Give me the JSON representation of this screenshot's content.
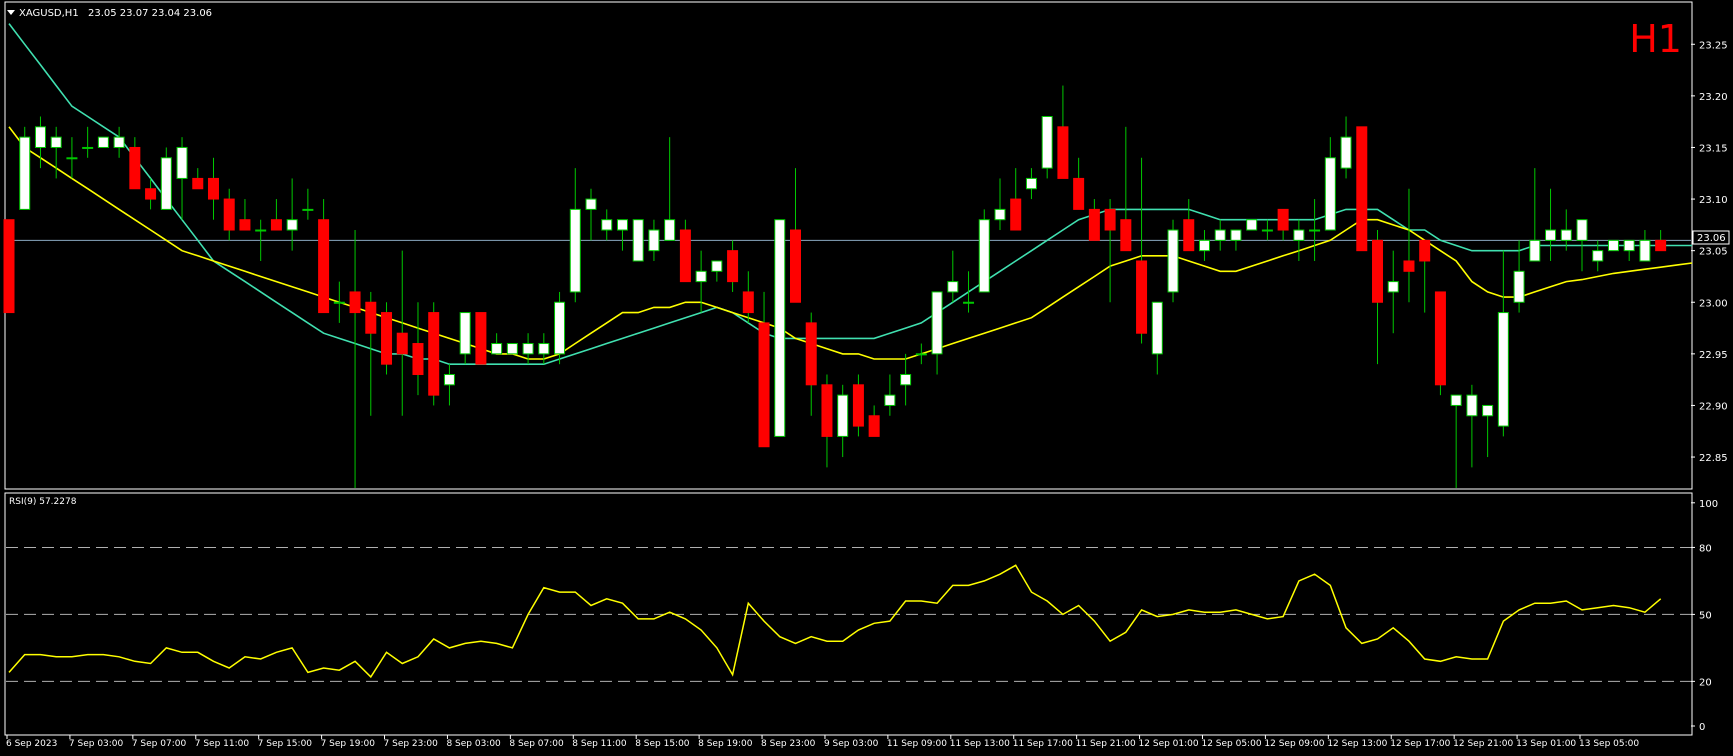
{
  "chart_data": [
    {
      "type": "candlestick",
      "symbol_label": "XAGUSD,H1",
      "ohlc_label": "23.05 23.07 23.04 23.06",
      "timeframe_badge": "H1",
      "current_price_label": "23.06",
      "current_price": 23.06,
      "ylim": [
        22.82,
        23.29
      ],
      "y_ticks": [
        "23.25",
        "23.20",
        "23.15",
        "23.10",
        "23.05",
        "23.00",
        "22.95",
        "22.90",
        "22.85"
      ],
      "y_tick_values": [
        23.25,
        23.2,
        23.15,
        23.1,
        23.05,
        23.0,
        22.95,
        22.9,
        22.85
      ],
      "x_ticks": [
        "6 Sep 2023",
        "7 Sep 03:00",
        "7 Sep 07:00",
        "7 Sep 11:00",
        "7 Sep 15:00",
        "7 Sep 19:00",
        "7 Sep 23:00",
        "8 Sep 03:00",
        "8 Sep 07:00",
        "8 Sep 11:00",
        "8 Sep 15:00",
        "8 Sep 19:00",
        "8 Sep 23:00",
        "9 Sep 03:00",
        "11 Sep 09:00",
        "11 Sep 13:00",
        "11 Sep 17:00",
        "11 Sep 21:00",
        "12 Sep 01:00",
        "12 Sep 05:00",
        "12 Sep 09:00",
        "12 Sep 13:00",
        "12 Sep 17:00",
        "12 Sep 21:00",
        "13 Sep 01:00",
        "13 Sep 05:00"
      ],
      "candles": [
        {
          "o": 23.08,
          "h": 23.08,
          "l": 22.99,
          "c": 22.99
        },
        {
          "o": 23.09,
          "h": 23.17,
          "l": 23.09,
          "c": 23.16
        },
        {
          "o": 23.15,
          "h": 23.18,
          "l": 23.13,
          "c": 23.17
        },
        {
          "o": 23.15,
          "h": 23.17,
          "l": 23.12,
          "c": 23.16
        },
        {
          "o": 23.14,
          "h": 23.16,
          "l": 23.12,
          "c": 23.14
        },
        {
          "o": 23.15,
          "h": 23.17,
          "l": 23.14,
          "c": 23.15
        },
        {
          "o": 23.15,
          "h": 23.16,
          "l": 23.15,
          "c": 23.16
        },
        {
          "o": 23.15,
          "h": 23.17,
          "l": 23.14,
          "c": 23.16
        },
        {
          "o": 23.15,
          "h": 23.16,
          "l": 23.11,
          "c": 23.11
        },
        {
          "o": 23.11,
          "h": 23.12,
          "l": 23.09,
          "c": 23.1
        },
        {
          "o": 23.09,
          "h": 23.15,
          "l": 23.09,
          "c": 23.14
        },
        {
          "o": 23.12,
          "h": 23.16,
          "l": 23.08,
          "c": 23.15
        },
        {
          "o": 23.12,
          "h": 23.13,
          "l": 23.11,
          "c": 23.11
        },
        {
          "o": 23.12,
          "h": 23.14,
          "l": 23.08,
          "c": 23.1
        },
        {
          "o": 23.1,
          "h": 23.11,
          "l": 23.06,
          "c": 23.07
        },
        {
          "o": 23.08,
          "h": 23.1,
          "l": 23.07,
          "c": 23.07
        },
        {
          "o": 23.07,
          "h": 23.08,
          "l": 23.04,
          "c": 23.07
        },
        {
          "o": 23.08,
          "h": 23.1,
          "l": 23.07,
          "c": 23.07
        },
        {
          "o": 23.07,
          "h": 23.12,
          "l": 23.05,
          "c": 23.08
        },
        {
          "o": 23.09,
          "h": 23.11,
          "l": 23.08,
          "c": 23.09
        },
        {
          "o": 23.08,
          "h": 23.1,
          "l": 22.99,
          "c": 22.99
        },
        {
          "o": 23.0,
          "h": 23.02,
          "l": 22.98,
          "c": 23.0
        },
        {
          "o": 23.01,
          "h": 23.07,
          "l": 22.82,
          "c": 22.99
        },
        {
          "o": 23.0,
          "h": 23.01,
          "l": 22.89,
          "c": 22.97
        },
        {
          "o": 22.99,
          "h": 23.0,
          "l": 22.93,
          "c": 22.94
        },
        {
          "o": 22.97,
          "h": 23.05,
          "l": 22.89,
          "c": 22.95
        },
        {
          "o": 22.96,
          "h": 23.0,
          "l": 22.91,
          "c": 22.93
        },
        {
          "o": 22.99,
          "h": 23.0,
          "l": 22.9,
          "c": 22.91
        },
        {
          "o": 22.92,
          "h": 22.94,
          "l": 22.9,
          "c": 22.93
        },
        {
          "o": 22.95,
          "h": 22.99,
          "l": 22.94,
          "c": 22.99
        },
        {
          "o": 22.99,
          "h": 22.99,
          "l": 22.94,
          "c": 22.94
        },
        {
          "o": 22.95,
          "h": 22.97,
          "l": 22.95,
          "c": 22.96
        },
        {
          "o": 22.95,
          "h": 22.96,
          "l": 22.95,
          "c": 22.96
        },
        {
          "o": 22.95,
          "h": 22.97,
          "l": 22.94,
          "c": 22.96
        },
        {
          "o": 22.95,
          "h": 22.97,
          "l": 22.94,
          "c": 22.96
        },
        {
          "o": 22.95,
          "h": 23.01,
          "l": 22.94,
          "c": 23.0
        },
        {
          "o": 23.01,
          "h": 23.13,
          "l": 23.0,
          "c": 23.09
        },
        {
          "o": 23.09,
          "h": 23.11,
          "l": 23.06,
          "c": 23.1
        },
        {
          "o": 23.07,
          "h": 23.09,
          "l": 23.06,
          "c": 23.08
        },
        {
          "o": 23.07,
          "h": 23.08,
          "l": 23.05,
          "c": 23.08
        },
        {
          "o": 23.04,
          "h": 23.08,
          "l": 23.04,
          "c": 23.08
        },
        {
          "o": 23.05,
          "h": 23.08,
          "l": 23.04,
          "c": 23.07
        },
        {
          "o": 23.06,
          "h": 23.16,
          "l": 23.06,
          "c": 23.08
        },
        {
          "o": 23.07,
          "h": 23.08,
          "l": 23.02,
          "c": 23.02
        },
        {
          "o": 23.02,
          "h": 23.05,
          "l": 22.99,
          "c": 23.03
        },
        {
          "o": 23.03,
          "h": 23.04,
          "l": 23.02,
          "c": 23.04
        },
        {
          "o": 23.05,
          "h": 23.06,
          "l": 23.01,
          "c": 23.02
        },
        {
          "o": 23.01,
          "h": 23.03,
          "l": 22.98,
          "c": 22.99
        },
        {
          "o": 22.98,
          "h": 23.01,
          "l": 22.86,
          "c": 22.86
        },
        {
          "o": 22.87,
          "h": 23.08,
          "l": 22.87,
          "c": 23.08
        },
        {
          "o": 23.07,
          "h": 23.13,
          "l": 23.0,
          "c": 23.0
        },
        {
          "o": 22.98,
          "h": 22.99,
          "l": 22.89,
          "c": 22.92
        },
        {
          "o": 22.92,
          "h": 22.93,
          "l": 22.84,
          "c": 22.87
        },
        {
          "o": 22.87,
          "h": 22.92,
          "l": 22.85,
          "c": 22.91
        },
        {
          "o": 22.92,
          "h": 22.93,
          "l": 22.87,
          "c": 22.88
        },
        {
          "o": 22.89,
          "h": 22.9,
          "l": 22.87,
          "c": 22.87
        },
        {
          "o": 22.9,
          "h": 22.93,
          "l": 22.89,
          "c": 22.91
        },
        {
          "o": 22.92,
          "h": 22.95,
          "l": 22.9,
          "c": 22.93
        },
        {
          "o": 22.95,
          "h": 22.96,
          "l": 22.94,
          "c": 22.95
        },
        {
          "o": 22.95,
          "h": 23.01,
          "l": 22.93,
          "c": 23.01
        },
        {
          "o": 23.01,
          "h": 23.05,
          "l": 23.0,
          "c": 23.02
        },
        {
          "o": 23.0,
          "h": 23.03,
          "l": 22.99,
          "c": 23.0
        },
        {
          "o": 23.01,
          "h": 23.09,
          "l": 23.01,
          "c": 23.08
        },
        {
          "o": 23.08,
          "h": 23.12,
          "l": 23.07,
          "c": 23.09
        },
        {
          "o": 23.1,
          "h": 23.13,
          "l": 23.07,
          "c": 23.07
        },
        {
          "o": 23.11,
          "h": 23.13,
          "l": 23.1,
          "c": 23.12
        },
        {
          "o": 23.13,
          "h": 23.18,
          "l": 23.12,
          "c": 23.18
        },
        {
          "o": 23.17,
          "h": 23.21,
          "l": 23.12,
          "c": 23.12
        },
        {
          "o": 23.12,
          "h": 23.14,
          "l": 23.09,
          "c": 23.09
        },
        {
          "o": 23.09,
          "h": 23.1,
          "l": 23.06,
          "c": 23.06
        },
        {
          "o": 23.09,
          "h": 23.1,
          "l": 23.0,
          "c": 23.07
        },
        {
          "o": 23.08,
          "h": 23.17,
          "l": 23.05,
          "c": 23.05
        },
        {
          "o": 23.04,
          "h": 23.14,
          "l": 22.96,
          "c": 22.97
        },
        {
          "o": 22.95,
          "h": 23.0,
          "l": 22.93,
          "c": 23.0
        },
        {
          "o": 23.01,
          "h": 23.08,
          "l": 23.0,
          "c": 23.07
        },
        {
          "o": 23.08,
          "h": 23.1,
          "l": 23.05,
          "c": 23.05
        },
        {
          "o": 23.05,
          "h": 23.07,
          "l": 23.04,
          "c": 23.06
        },
        {
          "o": 23.06,
          "h": 23.08,
          "l": 23.05,
          "c": 23.07
        },
        {
          "o": 23.06,
          "h": 23.07,
          "l": 23.05,
          "c": 23.07
        },
        {
          "o": 23.07,
          "h": 23.08,
          "l": 23.07,
          "c": 23.08
        },
        {
          "o": 23.07,
          "h": 23.08,
          "l": 23.06,
          "c": 23.07
        },
        {
          "o": 23.09,
          "h": 23.09,
          "l": 23.06,
          "c": 23.07
        },
        {
          "o": 23.06,
          "h": 23.08,
          "l": 23.04,
          "c": 23.07
        },
        {
          "o": 23.07,
          "h": 23.1,
          "l": 23.04,
          "c": 23.07
        },
        {
          "o": 23.07,
          "h": 23.16,
          "l": 23.07,
          "c": 23.14
        },
        {
          "o": 23.13,
          "h": 23.18,
          "l": 23.12,
          "c": 23.16
        },
        {
          "o": 23.17,
          "h": 23.17,
          "l": 23.05,
          "c": 23.05
        },
        {
          "o": 23.06,
          "h": 23.07,
          "l": 22.94,
          "c": 23.0
        },
        {
          "o": 23.01,
          "h": 23.05,
          "l": 22.97,
          "c": 23.02
        },
        {
          "o": 23.04,
          "h": 23.11,
          "l": 23.0,
          "c": 23.03
        },
        {
          "o": 23.06,
          "h": 23.06,
          "l": 22.99,
          "c": 23.04
        },
        {
          "o": 23.01,
          "h": 23.01,
          "l": 22.91,
          "c": 22.92
        },
        {
          "o": 22.9,
          "h": 22.91,
          "l": 22.82,
          "c": 22.91
        },
        {
          "o": 22.89,
          "h": 22.92,
          "l": 22.84,
          "c": 22.91
        },
        {
          "o": 22.89,
          "h": 22.9,
          "l": 22.85,
          "c": 22.9
        },
        {
          "o": 22.88,
          "h": 23.05,
          "l": 22.87,
          "c": 22.99
        },
        {
          "o": 23.0,
          "h": 23.06,
          "l": 22.99,
          "c": 23.03
        },
        {
          "o": 23.04,
          "h": 23.13,
          "l": 23.04,
          "c": 23.06
        },
        {
          "o": 23.06,
          "h": 23.11,
          "l": 23.04,
          "c": 23.07
        },
        {
          "o": 23.06,
          "h": 23.09,
          "l": 23.05,
          "c": 23.07
        },
        {
          "o": 23.06,
          "h": 23.08,
          "l": 23.03,
          "c": 23.08
        },
        {
          "o": 23.04,
          "h": 23.06,
          "l": 23.03,
          "c": 23.05
        },
        {
          "o": 23.05,
          "h": 23.06,
          "l": 23.05,
          "c": 23.06
        },
        {
          "o": 23.05,
          "h": 23.06,
          "l": 23.04,
          "c": 23.06
        },
        {
          "o": 23.04,
          "h": 23.07,
          "l": 23.04,
          "c": 23.06
        },
        {
          "o": 23.06,
          "h": 23.07,
          "l": 23.05,
          "c": 23.05
        }
      ],
      "series": [
        {
          "values": [
            23.27,
            23.25,
            23.23,
            23.21,
            23.19,
            23.18,
            23.17,
            23.16,
            23.14,
            23.12,
            23.1,
            23.08,
            23.06,
            23.04,
            23.03,
            23.02,
            23.01,
            23.0,
            22.99,
            22.98,
            22.97,
            22.965,
            22.96,
            22.955,
            22.95,
            22.95,
            22.945,
            22.945,
            22.94,
            22.94,
            22.94,
            22.94,
            22.94,
            22.94,
            22.94,
            22.945,
            22.95,
            22.955,
            22.96,
            22.965,
            22.97,
            22.975,
            22.98,
            22.985,
            22.99,
            22.995,
            22.99,
            22.98,
            22.97,
            22.965,
            22.965,
            22.965,
            22.965,
            22.965,
            22.965,
            22.965,
            22.97,
            22.975,
            22.98,
            22.99,
            23.0,
            23.01,
            23.02,
            23.03,
            23.04,
            23.05,
            23.06,
            23.07,
            23.08,
            23.085,
            23.09,
            23.09,
            23.09,
            23.09,
            23.09,
            23.09,
            23.085,
            23.08,
            23.08,
            23.08,
            23.08,
            23.08,
            23.08,
            23.08,
            23.085,
            23.09,
            23.09,
            23.09,
            23.08,
            23.07,
            23.07,
            23.06,
            23.055,
            23.05,
            23.05,
            23.05,
            23.05,
            23.055,
            23.055,
            23.055,
            23.055,
            23.055,
            23.055,
            23.055,
            23.055,
            23.055,
            23.055,
            23.055
          ]
        },
        {
          "values": [
            23.17,
            23.15,
            23.14,
            23.13,
            23.12,
            23.11,
            23.1,
            23.09,
            23.08,
            23.07,
            23.06,
            23.05,
            23.045,
            23.04,
            23.035,
            23.03,
            23.025,
            23.02,
            23.015,
            23.01,
            23.005,
            23.0,
            22.995,
            22.99,
            22.985,
            22.98,
            22.975,
            22.97,
            22.965,
            22.96,
            22.955,
            22.95,
            22.95,
            22.945,
            22.945,
            22.95,
            22.96,
            22.97,
            22.98,
            22.99,
            22.99,
            22.995,
            22.995,
            23.0,
            23.0,
            22.995,
            22.99,
            22.985,
            22.98,
            22.975,
            22.965,
            22.96,
            22.955,
            22.95,
            22.95,
            22.945,
            22.945,
            22.945,
            22.95,
            22.955,
            22.96,
            22.965,
            22.97,
            22.975,
            22.98,
            22.985,
            22.995,
            23.005,
            23.015,
            23.025,
            23.035,
            23.04,
            23.045,
            23.045,
            23.045,
            23.04,
            23.035,
            23.03,
            23.03,
            23.035,
            23.04,
            23.045,
            23.05,
            23.055,
            23.06,
            23.07,
            23.08,
            23.08,
            23.075,
            23.07,
            23.06,
            23.05,
            23.04,
            23.02,
            23.01,
            23.005,
            23.005,
            23.01,
            23.015,
            23.02,
            23.022,
            23.025,
            23.028,
            23.03,
            23.032,
            23.034,
            23.036,
            23.038
          ]
        }
      ]
    },
    {
      "type": "line",
      "indicator_label": "RSI(9) 57.2278",
      "ylim": [
        0,
        100
      ],
      "y_ticks": [
        "100",
        "80",
        "50",
        "20",
        "0"
      ],
      "y_tick_values": [
        100,
        80,
        50,
        20,
        0
      ],
      "levels": [
        80,
        50,
        20
      ],
      "series": [
        {
          "values": [
            24,
            32,
            32,
            31,
            31,
            32,
            32,
            31,
            29,
            28,
            35,
            33,
            33,
            29,
            26,
            31,
            30,
            33,
            35,
            24,
            26,
            25,
            29,
            22,
            33,
            28,
            31,
            39,
            35,
            37,
            38,
            37,
            35,
            50,
            62,
            60,
            60,
            54,
            57,
            55,
            48,
            48,
            51,
            48,
            43,
            35,
            23,
            55,
            47,
            40,
            37,
            40,
            38,
            38,
            43,
            46,
            47,
            56,
            56,
            55,
            63,
            63,
            65,
            68,
            72,
            60,
            56,
            50,
            54,
            47,
            38,
            42,
            52,
            49,
            50,
            52,
            51,
            51,
            52,
            50,
            48,
            49,
            65,
            68,
            63,
            44,
            37,
            39,
            44,
            38,
            30,
            29,
            31,
            30,
            30,
            47,
            52,
            55,
            55,
            56,
            52,
            53,
            54,
            53,
            51,
            57
          ]
        }
      ]
    }
  ],
  "colors": {
    "background": "#000000",
    "frame": "#ffffff",
    "bull_candle": "#ffffff",
    "bear_candle": "#ff0000",
    "wick": "#00c800",
    "ma_fast": "#ffff00",
    "ma_slow": "#40e0b0",
    "rsi_line": "#ffff00",
    "level_line": "#b0b0b0",
    "price_line": "#8aa8c0",
    "timeframe_badge": "#ff0000",
    "axis_text": "#ffffff"
  }
}
